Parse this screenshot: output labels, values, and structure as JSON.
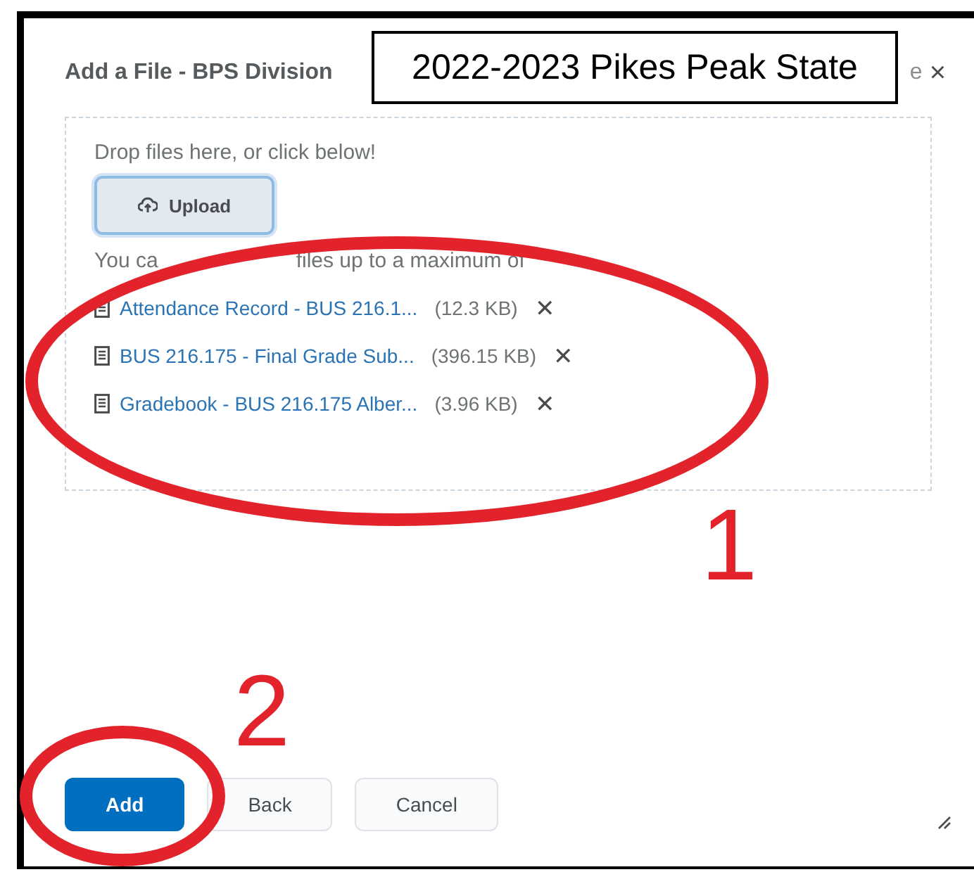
{
  "dialog": {
    "title": "Add a File - BPS Division",
    "title_tail": "e",
    "close": "×"
  },
  "overlay_label": "2022-2023 Pikes Peak State",
  "dropzone": {
    "prompt": "Drop files here, or click below!",
    "upload_button": "Upload",
    "limit_parts": [
      "You ca",
      "files up to a maximum of"
    ]
  },
  "files": [
    {
      "name": "Attendance Record - BUS 216.1...",
      "size": "(12.3 KB)",
      "remove": "✕"
    },
    {
      "name": "BUS 216.175 - Final Grade Sub...",
      "size": "(396.15 KB)",
      "remove": "✕"
    },
    {
      "name": "Gradebook - BUS 216.175 Alber...",
      "size": "(3.96 KB)",
      "remove": "✕"
    }
  ],
  "buttons": [
    {
      "label": "Add",
      "kind": "primary"
    },
    {
      "label": "Back",
      "kind": "secondary"
    },
    {
      "label": "Cancel",
      "kind": "secondary"
    }
  ],
  "annotations": [
    {
      "kind": "ellipse"
    },
    {
      "kind": "number",
      "text": "1"
    },
    {
      "kind": "number",
      "text": "2"
    },
    {
      "kind": "ellipse"
    }
  ]
}
